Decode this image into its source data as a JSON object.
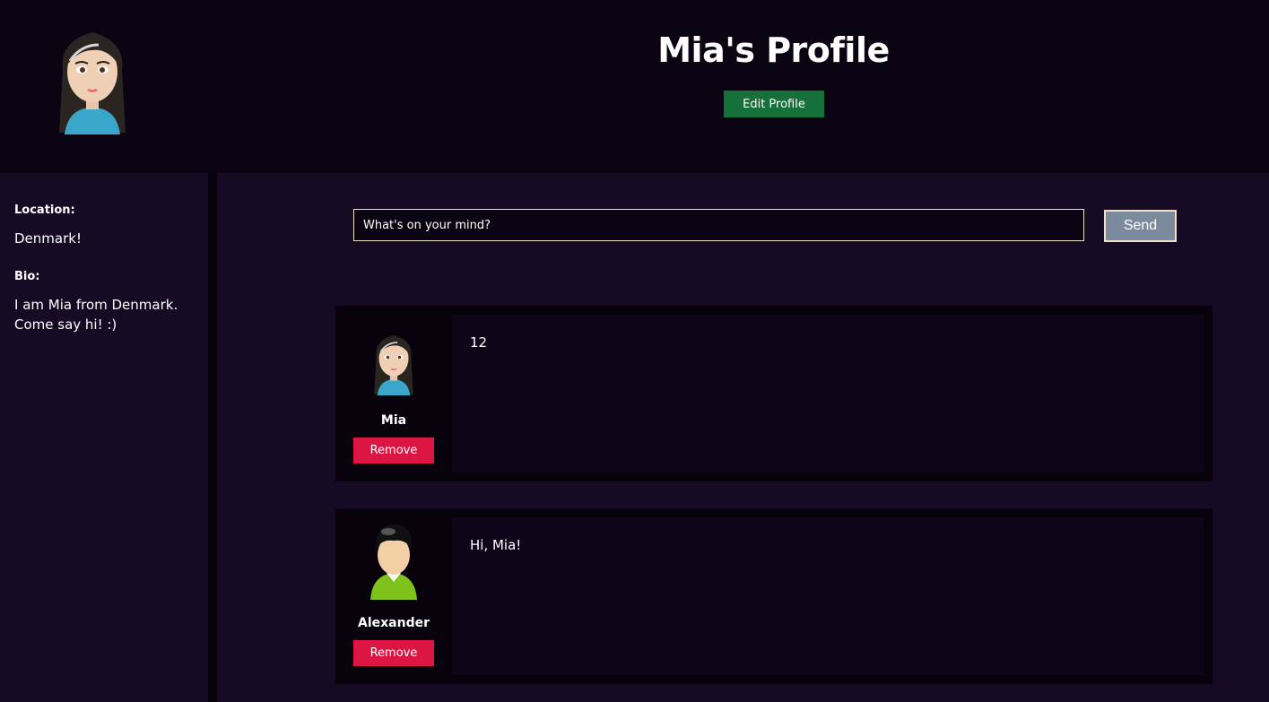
{
  "header": {
    "title": "Mia's Profile",
    "edit_button": "Edit Profile",
    "avatar_icon": "girl-avatar-icon"
  },
  "sidebar": {
    "location_label": "Location:",
    "location_value": "Denmark!",
    "bio_label": "Bio:",
    "bio_value": "I am Mia from Denmark. Come say hi! :)"
  },
  "composer": {
    "placeholder": "What's on your mind?",
    "send_label": "Send"
  },
  "posts": [
    {
      "author": "Mia",
      "avatar_icon": "girl-avatar-icon",
      "text": "12",
      "remove_label": "Remove"
    },
    {
      "author": "Alexander",
      "avatar_icon": "user-avatar-icon",
      "text": "Hi, Mia!",
      "remove_label": "Remove"
    }
  ],
  "colors": {
    "header_bg": "#0b0412",
    "page_bg": "#160a24",
    "edit_button": "#15703a",
    "remove_button": "#dc1642",
    "send_button": "#7b8a9d"
  }
}
